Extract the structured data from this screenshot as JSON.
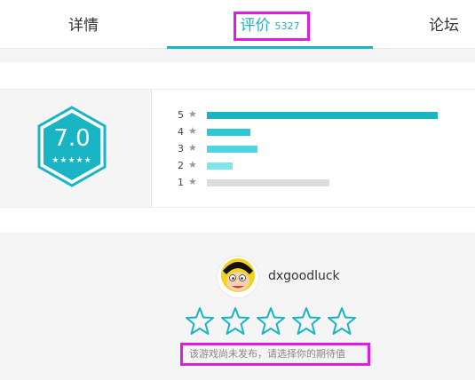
{
  "tabs": {
    "detail": "详情",
    "review": "评价",
    "review_count": "5327",
    "forum": "论坛"
  },
  "rating": {
    "score": "7.0",
    "score_stars_text": "★★★★★",
    "distribution": [
      {
        "star": "5",
        "fraction": 1.0,
        "color": "#19b5c4"
      },
      {
        "star": "4",
        "fraction": 0.19,
        "color": "#2cc7d8"
      },
      {
        "star": "3",
        "fraction": 0.22,
        "color": "#4fd6e2"
      },
      {
        "star": "2",
        "fraction": 0.11,
        "color": "#7fe4ee"
      },
      {
        "star": "1",
        "fraction": 0.53,
        "color": "#dddddd"
      }
    ],
    "star_glyph": "★"
  },
  "comment": {
    "username": "dxgoodluck",
    "hint": "该游戏尚未发布，请选择你的期待值"
  },
  "colors": {
    "accent": "#19b5c4",
    "highlight": "#e21ae6"
  }
}
